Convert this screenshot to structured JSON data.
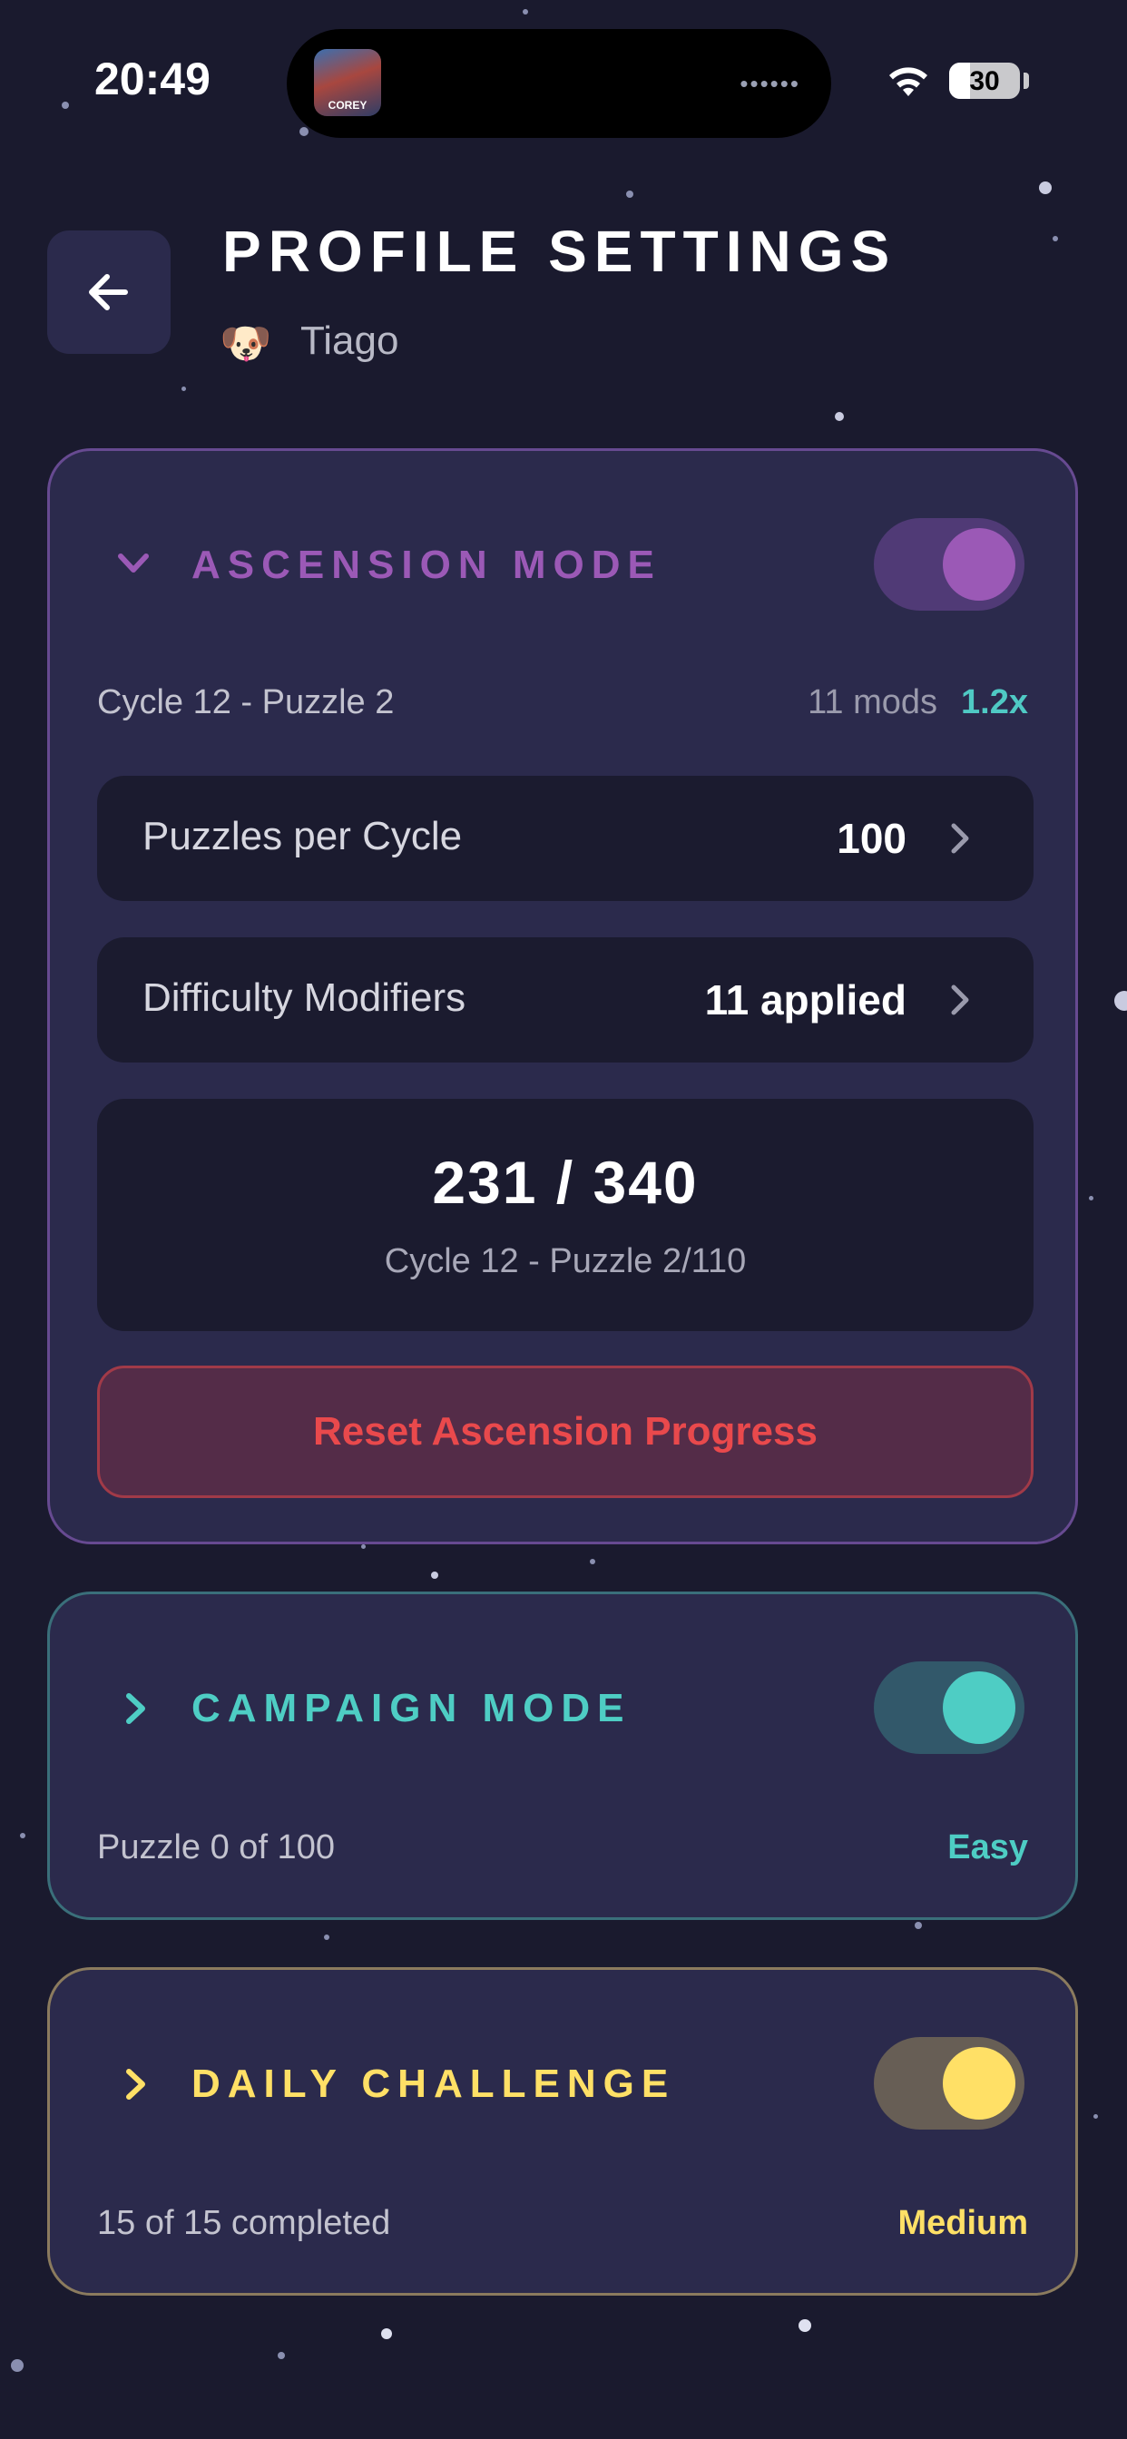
{
  "status_bar": {
    "time": "20:49",
    "app_icon_text": "COREY",
    "island_dots": "••••••",
    "battery_level": "30",
    "battery_fraction": 0.3
  },
  "header": {
    "title": "PROFILE SETTINGS",
    "avatar": "🐶",
    "username": "Tiago"
  },
  "ascension": {
    "title": "ASCENSION MODE",
    "enabled": true,
    "cycle_label": "Cycle 12 - Puzzle 2",
    "mods_label": "11 mods",
    "multiplier": "1.2x",
    "rows": [
      {
        "label": "Puzzles per Cycle",
        "value": "100"
      },
      {
        "label": "Difficulty Modifiers",
        "value": "11 applied"
      }
    ],
    "progress_main": "231 / 340",
    "progress_sub": "Cycle 12 - Puzzle 2/110",
    "reset_label": "Reset Ascension Progress"
  },
  "campaign": {
    "title": "CAMPAIGN MODE",
    "enabled": true,
    "progress": "Puzzle 0 of 100",
    "difficulty": "Easy"
  },
  "daily": {
    "title": "DAILY CHALLENGE",
    "enabled": true,
    "progress": "15 of 15 completed",
    "difficulty": "Medium"
  },
  "colors": {
    "background": "#1a1a2e",
    "card": "#2b2a4c",
    "ascension_accent": "#9b59b6",
    "campaign_accent": "#4ecdc4",
    "daily_accent": "#ffe066",
    "danger": "#e9494c"
  },
  "icons": {
    "back": "arrow-left-icon",
    "expanded": "chevron-down-icon",
    "collapsed": "chevron-right-icon",
    "row": "chevron-right-icon"
  }
}
